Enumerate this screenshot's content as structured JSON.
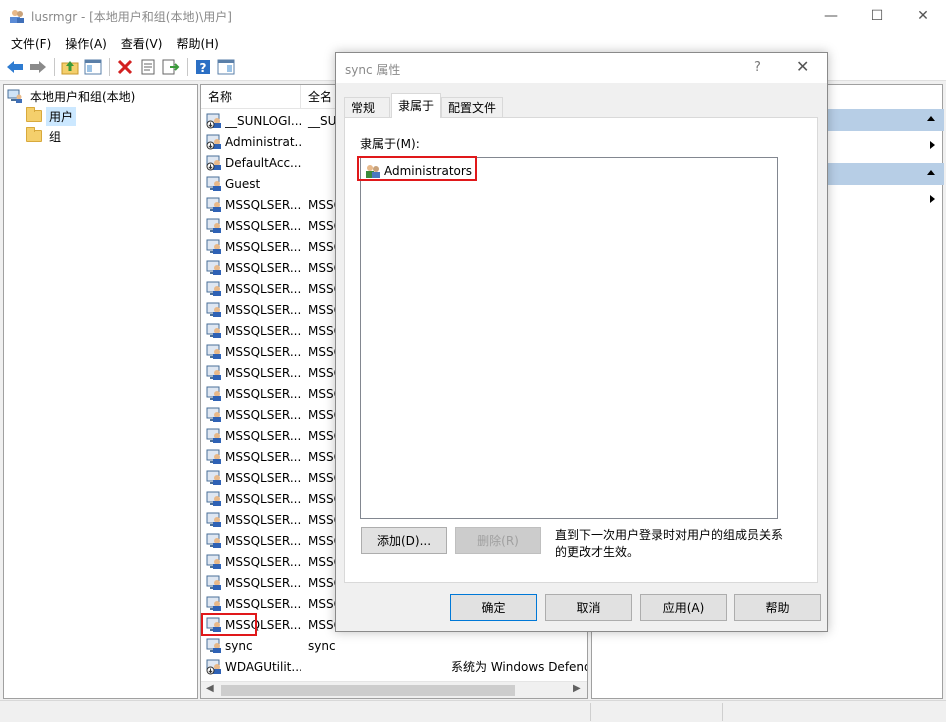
{
  "window": {
    "title": "lusrmgr - [本地用户和组(本地)\\用户]",
    "controls": {
      "minimize": "—",
      "maximize": "☐",
      "close": "✕"
    }
  },
  "menu": [
    "文件(F)",
    "操作(A)",
    "查看(V)",
    "帮助(H)"
  ],
  "toolbar": [
    "back-icon",
    "forward-icon",
    "up-folder-icon",
    "show-hide-tree-icon",
    "delete-icon",
    "properties-icon",
    "export-icon",
    "help-icon",
    "show-hide-action-pane-icon"
  ],
  "tree": {
    "root": "本地用户和组(本地)",
    "items": [
      {
        "label": "用户",
        "selected": true
      },
      {
        "label": "组",
        "selected": false
      }
    ]
  },
  "list": {
    "columns": [
      "名称",
      "全名"
    ],
    "rows": [
      {
        "name": "__SUNLOGI...",
        "fullname": "__SUN",
        "desc": "",
        "icon": "user-disabled"
      },
      {
        "name": "Administrat...",
        "fullname": "",
        "desc": "",
        "icon": "user-disabled"
      },
      {
        "name": "DefaultAcc...",
        "fullname": "",
        "desc": "",
        "icon": "user-disabled"
      },
      {
        "name": "Guest",
        "fullname": "",
        "desc": "",
        "icon": "user"
      },
      {
        "name": "MSSQLSER...",
        "fullname": "MSSQ",
        "desc": "",
        "icon": "user"
      },
      {
        "name": "MSSQLSER...",
        "fullname": "MSSQ",
        "desc": "",
        "icon": "user"
      },
      {
        "name": "MSSQLSER...",
        "fullname": "MSSQ",
        "desc": "",
        "icon": "user"
      },
      {
        "name": "MSSQLSER...",
        "fullname": "MSSQ",
        "desc": "",
        "icon": "user"
      },
      {
        "name": "MSSQLSER...",
        "fullname": "MSSQ",
        "desc": "",
        "icon": "user"
      },
      {
        "name": "MSSQLSER...",
        "fullname": "MSSQ",
        "desc": "",
        "icon": "user"
      },
      {
        "name": "MSSQLSER...",
        "fullname": "MSSQ",
        "desc": "",
        "icon": "user"
      },
      {
        "name": "MSSQLSER...",
        "fullname": "MSSQ",
        "desc": "",
        "icon": "user"
      },
      {
        "name": "MSSQLSER...",
        "fullname": "MSSQ",
        "desc": "",
        "icon": "user"
      },
      {
        "name": "MSSQLSER...",
        "fullname": "MSSQ",
        "desc": "",
        "icon": "user"
      },
      {
        "name": "MSSQLSER...",
        "fullname": "MSSQ",
        "desc": "",
        "icon": "user"
      },
      {
        "name": "MSSQLSER...",
        "fullname": "MSSQ",
        "desc": "",
        "icon": "user"
      },
      {
        "name": "MSSQLSER...",
        "fullname": "MSSQ",
        "desc": "",
        "icon": "user"
      },
      {
        "name": "MSSQLSER...",
        "fullname": "MSSQ",
        "desc": "",
        "icon": "user"
      },
      {
        "name": "MSSQLSER...",
        "fullname": "MSSQ",
        "desc": "",
        "icon": "user"
      },
      {
        "name": "MSSQLSER...",
        "fullname": "MSSQ",
        "desc": "",
        "icon": "user"
      },
      {
        "name": "MSSQLSER...",
        "fullname": "MSSQ",
        "desc": "",
        "icon": "user"
      },
      {
        "name": "MSSQLSER...",
        "fullname": "MSSQ",
        "desc": "",
        "icon": "user"
      },
      {
        "name": "MSSQLSER...",
        "fullname": "MSSQ",
        "desc": "",
        "icon": "user"
      },
      {
        "name": "MSSQLSER...",
        "fullname": "MSSQ",
        "desc": "",
        "icon": "user"
      },
      {
        "name": "MSSQLSER...",
        "fullname": "MSSQ",
        "desc": "",
        "icon": "user"
      },
      {
        "name": "sync",
        "fullname": "sync",
        "desc": "",
        "icon": "user",
        "selected": true
      },
      {
        "name": "WDAGUtilit...",
        "fullname": "",
        "desc": "系统为 Windows Defender",
        "icon": "user-disabled"
      }
    ]
  },
  "dialog": {
    "title": "sync 属性",
    "help": "?",
    "close": "✕",
    "tabs": [
      "常规",
      "隶属于",
      "配置文件"
    ],
    "active_tab": 1,
    "member_label": "隶属于(M):",
    "groups": [
      "Administrators"
    ],
    "add_button": "添加(D)...",
    "remove_button": "删除(R)",
    "note": "直到下一次用户登录时对用户的组成员关系的更改才生效。",
    "ok": "确定",
    "cancel": "取消",
    "apply": "应用(A)",
    "help_button": "帮助"
  },
  "colors": {
    "highlight_box": "#e0181a",
    "selection": "#cce8ff",
    "action_band": "#b7cee6"
  }
}
